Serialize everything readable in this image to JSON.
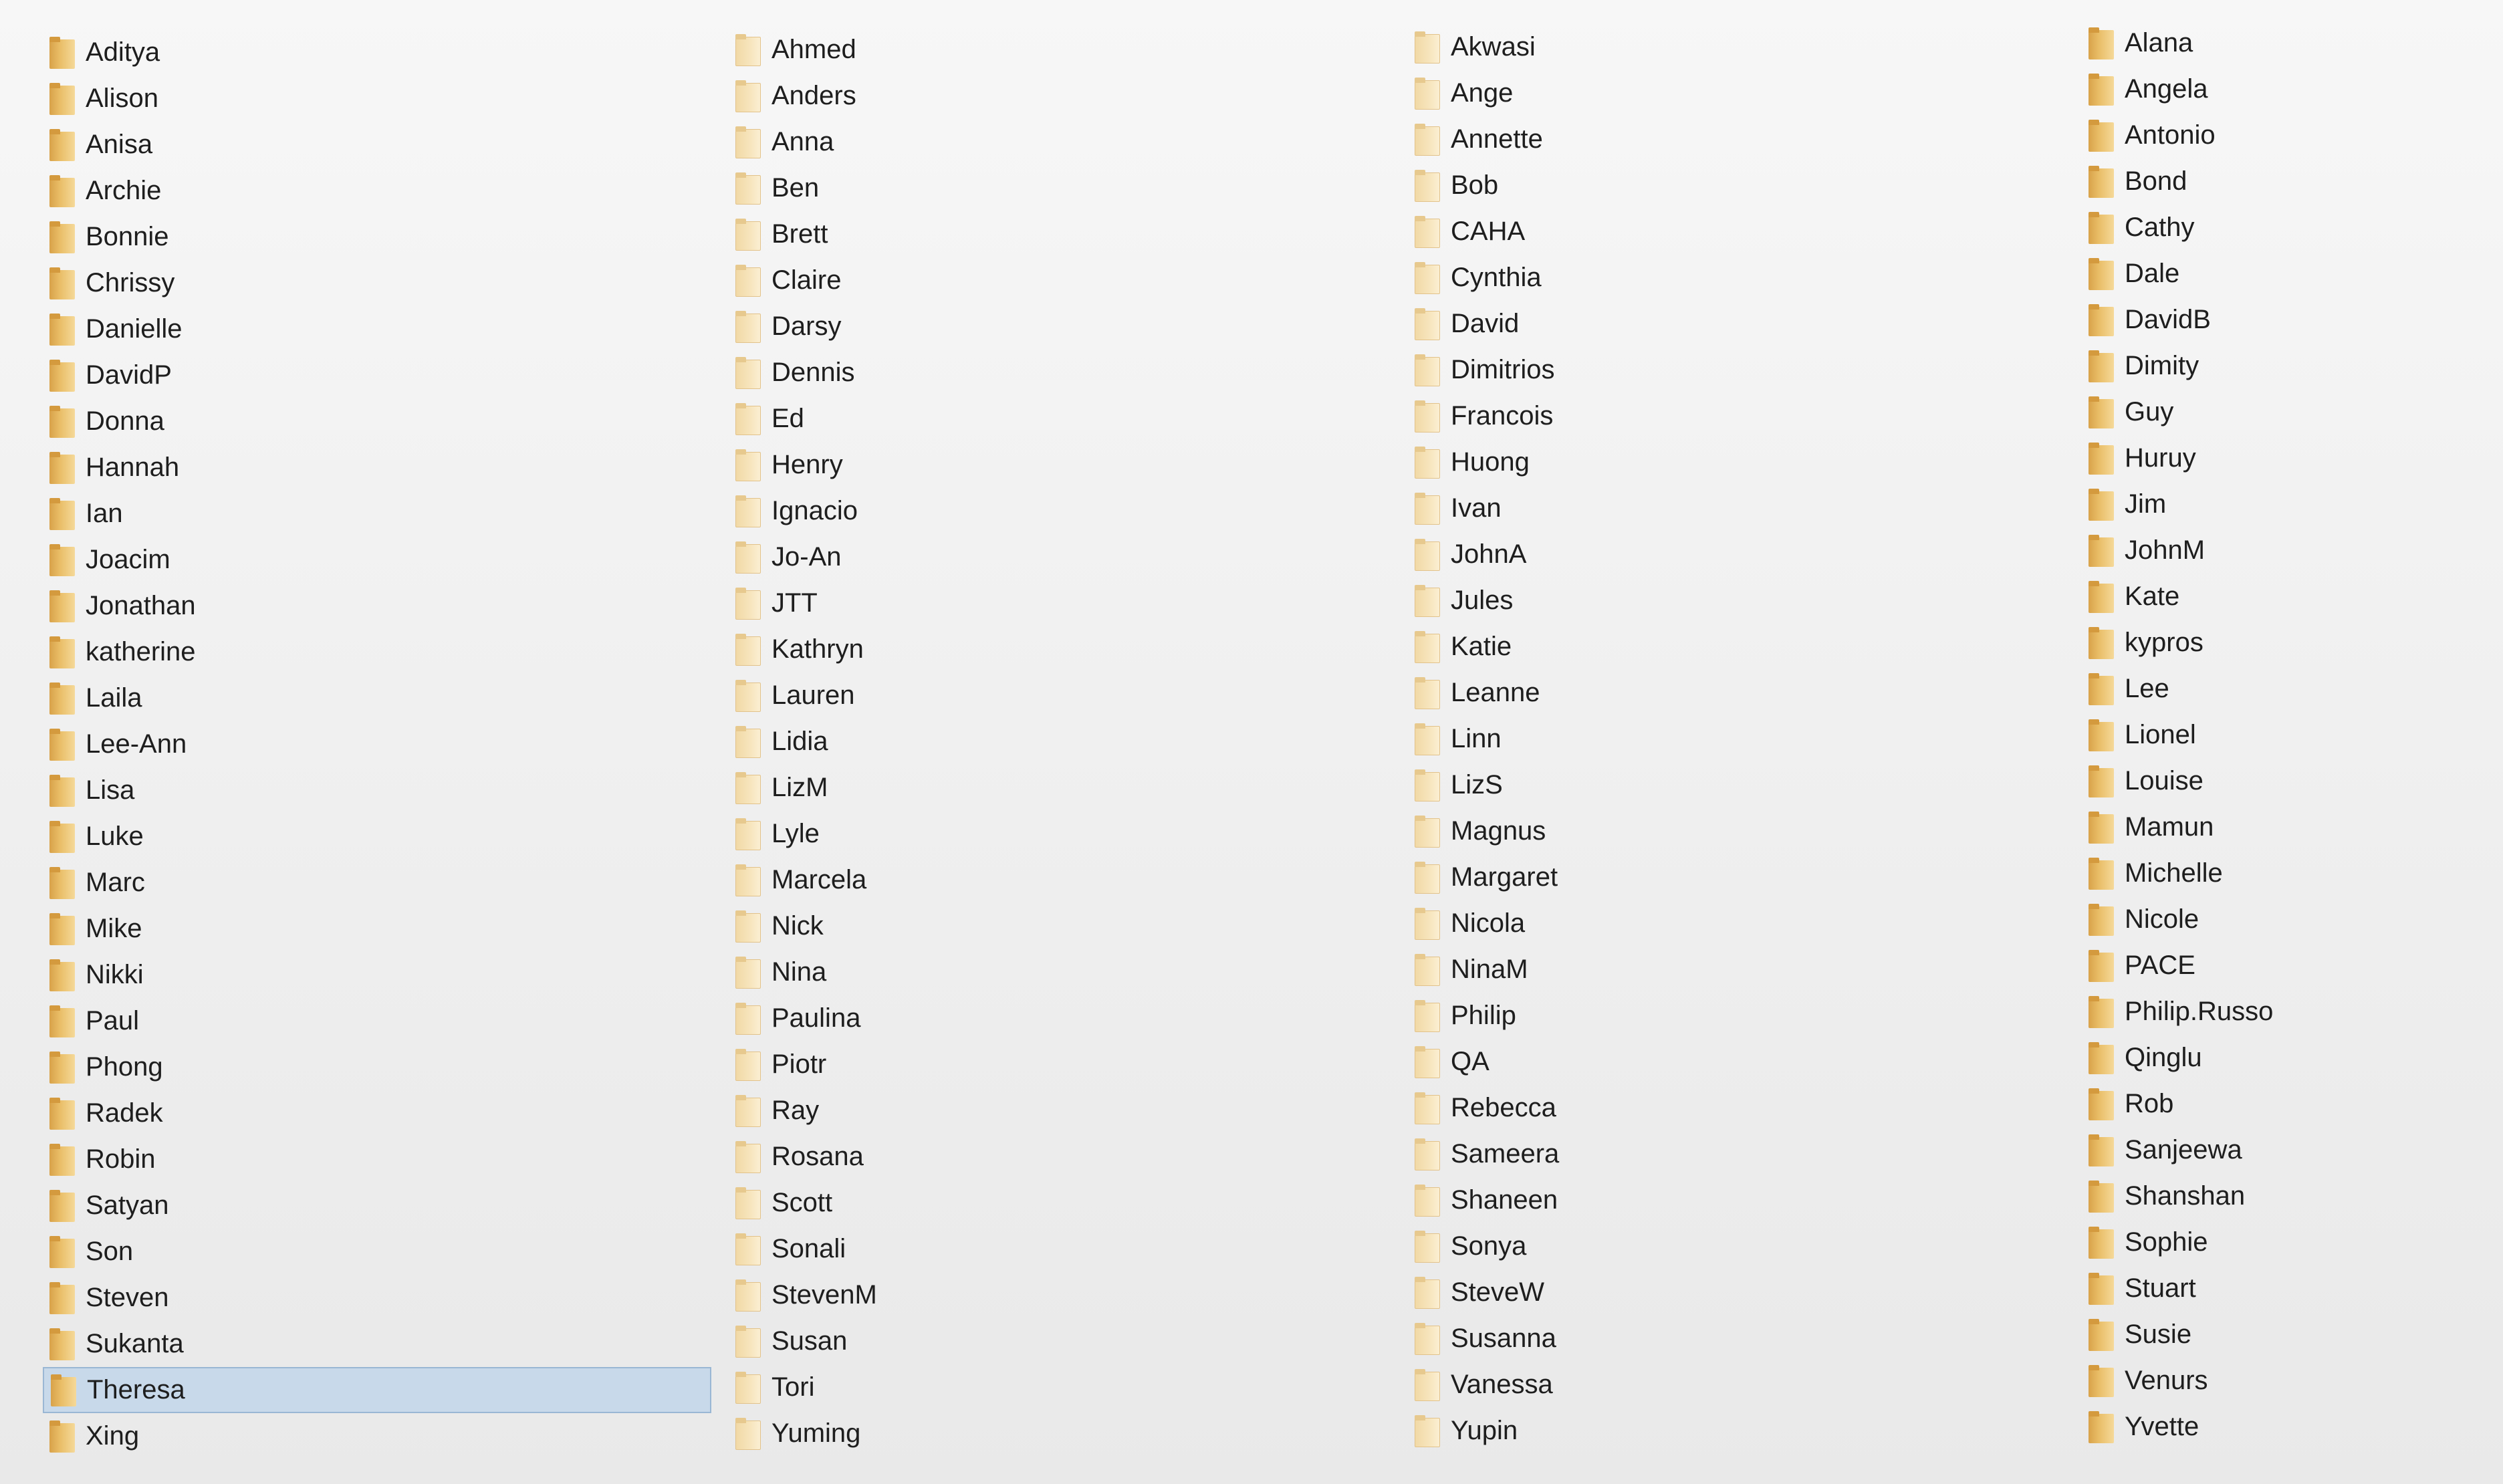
{
  "columns": [
    {
      "items": [
        "Aditya",
        "Alison",
        "Anisa",
        "Archie",
        "Bonnie",
        "Chrissy",
        "Danielle",
        "DavidP",
        "Donna",
        "Hannah",
        "Ian",
        "Joacim",
        "Jonathan",
        "katherine",
        "Laila",
        "Lee-Ann",
        "Lisa",
        "Luke",
        "Marc",
        "Mike",
        "Nikki",
        "Paul",
        "Phong",
        "Radek",
        "Robin",
        "Satyan",
        "Son",
        "Steven",
        "Sukanta",
        "Theresa",
        "Xing"
      ],
      "selected_index": 29
    },
    {
      "items": [
        "Ahmed",
        "Anders",
        "Anna",
        "Ben",
        "Brett",
        "Claire",
        "Darsy",
        "Dennis",
        "Ed",
        "Henry",
        "Ignacio",
        "Jo-An",
        "JTT",
        "Kathryn",
        "Lauren",
        "Lidia",
        "LizM",
        "Lyle",
        "Marcela",
        "Nick",
        "Nina",
        "Paulina",
        "Piotr",
        "Ray",
        "Rosana",
        "Scott",
        "Sonali",
        "StevenM",
        "Susan",
        "Tori",
        "Yuming"
      ]
    },
    {
      "items": [
        "Akwasi",
        "Ange",
        "Annette",
        "Bob",
        "CAHA",
        "Cynthia",
        "David",
        "Dimitrios",
        "Francois",
        "Huong",
        "Ivan",
        "JohnA",
        "Jules",
        "Katie",
        "Leanne",
        "Linn",
        "LizS",
        "Magnus",
        "Margaret",
        "Nicola",
        "NinaM",
        "Philip",
        "QA",
        "Rebecca",
        "Sameera",
        "Shaneen",
        "Sonya",
        "SteveW",
        "Susanna",
        "Vanessa",
        "Yupin"
      ]
    },
    {
      "items": [
        "Alana",
        "Angela",
        "Antonio",
        "Bond",
        "Cathy",
        "Dale",
        "DavidB",
        "Dimity",
        "Guy",
        "Huruy",
        "Jim",
        "JohnM",
        "Kate",
        "kypros",
        "Lee",
        "Lionel",
        "Louise",
        "Mamun",
        "Michelle",
        "Nicole",
        "PACE",
        "Philip.Russo",
        "Qinglu",
        "Rob",
        "Sanjeewa",
        "Shanshan",
        "Sophie",
        "Stuart",
        "Susie",
        "Venurs",
        "Yvette"
      ]
    }
  ],
  "colors": {
    "selection_background": "#c8d9ea",
    "folder_dark": "#d8a24a",
    "folder_light": "#f7e5bd"
  },
  "icon": "folder-icon"
}
